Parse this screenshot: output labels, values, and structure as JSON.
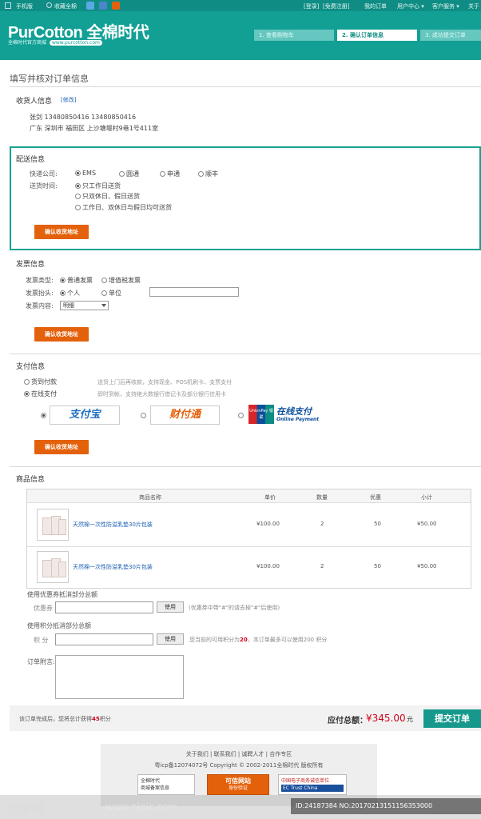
{
  "topbar": {
    "mobile": "手机版",
    "favorite": "收藏全棉",
    "login": "[登录]",
    "register": "[免费注册]",
    "my_orders": "我的订单",
    "user_center": "用户中心 ▾",
    "customer_service": "客户服务 ▾",
    "about": "关于"
  },
  "header": {
    "logo_text": "PurCotton 全棉时代",
    "logo_sub": "全棉时代官方商城",
    "logo_url": "www.purcotton.com",
    "steps": [
      "1. 查看购物车",
      "2. 确认订单信息",
      "3. 成功提交订单"
    ]
  },
  "page_title": "填写并核对订单信息",
  "receiver": {
    "title": "收货人信息",
    "edit": "[修改]",
    "line1": "张剑  13480850416  13480850416",
    "line2": "广东 深圳市 福田区   上沙塘堰村9巷1号411室"
  },
  "delivery": {
    "title": "配送信息",
    "courier_label": "快递公司:",
    "couriers": [
      "EMS",
      "圆通",
      "申通",
      "顺丰"
    ],
    "time_label": "送货时间:",
    "times": [
      "只工作日送货",
      "只双休日、假日送货",
      "工作日、双休日与假日均可送货"
    ],
    "confirm": "确认收货地址"
  },
  "invoice": {
    "title": "发票信息",
    "type_label": "发票类型:",
    "types": [
      "普通发票",
      "增值税发票"
    ],
    "head_label": "发票抬头:",
    "heads": [
      "个人",
      "单位"
    ],
    "content_label": "发票内容:",
    "content_value": "明细",
    "confirm": "确认收货地址"
  },
  "payment": {
    "title": "支付信息",
    "cod": "货到付款",
    "cod_desc": "送货上门后再收款，支持现金、POS机刷卡、支票支付",
    "online": "在线支付",
    "online_desc": "即时到帐，支持绝大数银行借记卡及部分银行信用卡",
    "logos": [
      "支付宝",
      "财付通",
      "在线支付"
    ],
    "unionpay_sub": "Online Payment",
    "unionpay_mark": "UnionPay 银联",
    "confirm": "确认收货地址"
  },
  "goods": {
    "title": "商品信息",
    "headers": [
      "商品名称",
      "单价",
      "数量",
      "优惠",
      "小计"
    ],
    "rows": [
      {
        "name": "天然棉一次性防溢乳垫30片包装",
        "price": "¥100.00",
        "qty": "2",
        "discount": "50",
        "subtotal": "¥50.00"
      },
      {
        "name": "天然棉一次性防溢乳垫30片包装",
        "price": "¥100.00",
        "qty": "2",
        "discount": "50",
        "subtotal": "¥50.00"
      }
    ]
  },
  "coupon": {
    "title": "使用优惠券抵消部分总额",
    "label": "优惠券",
    "button": "使用",
    "note": "(优惠券中带\"#\"的请去掉\"#\"后使用)"
  },
  "points": {
    "title": "使用积分抵消部分总额",
    "label": "积  分",
    "button": "使用",
    "note_pre": "您当前的可用积分为",
    "note_value": "20",
    "note_post": "，本订单最多可以使用200 积分"
  },
  "remark": {
    "label": "订单附言:"
  },
  "total": {
    "earn_pre": "该订单完成后，您将总计获得",
    "earn_value": "45",
    "earn_post": "积分",
    "label": "应付总额：",
    "amount": "¥345.00",
    "unit": "元",
    "submit": "提交订单"
  },
  "footer": {
    "links": "关于我们  |  联系我们  |  诚聘人才  |  合作专区",
    "copyright": "粤icp备12074072号  Copyright © 2002-2011全棉时代 版权所有",
    "badge1": "全棉时代\n商城备案信息",
    "badge2_title": "可信网站",
    "badge2_sub": "身份验证",
    "badge3_title": "中国电子商务诚信单位",
    "badge3_sub": "EC Trust China"
  },
  "watermark": {
    "logo": "昵享网",
    "url": "www.nipic.com",
    "id": "ID:24187384 NO:20170213151156353000"
  },
  "colors": {
    "brand": "#12a095",
    "accent_orange": "#e4610b",
    "price_red": "#d0021b"
  }
}
